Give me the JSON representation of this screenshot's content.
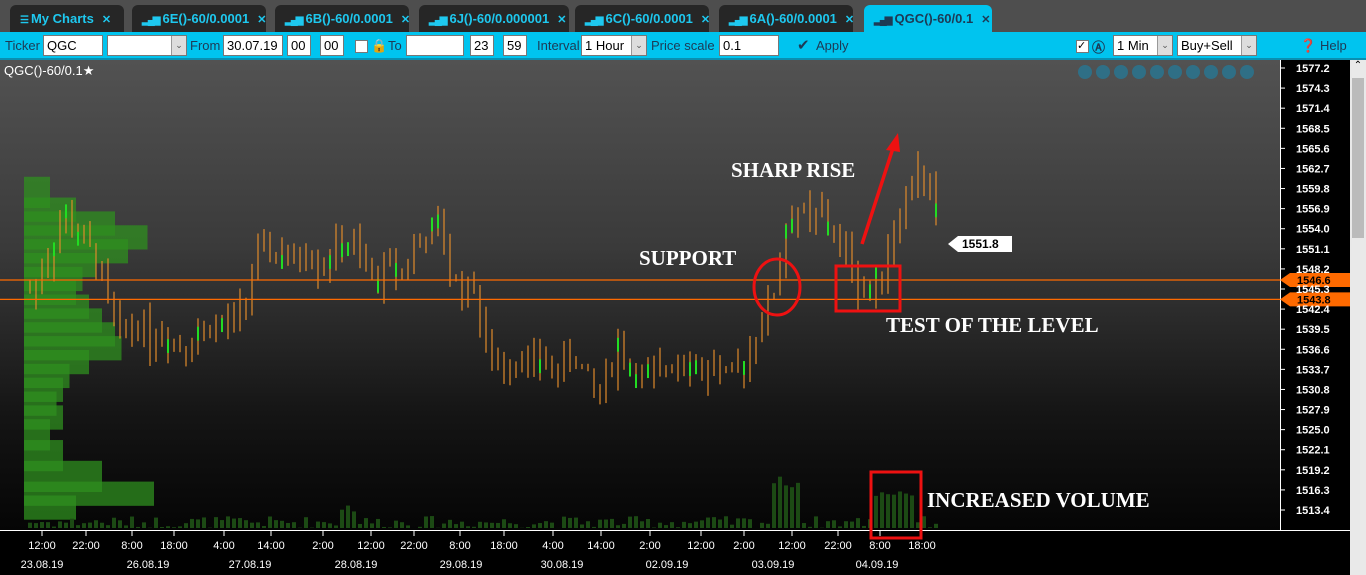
{
  "tabs": [
    {
      "label": "My Charts",
      "icon": "menu-icon"
    },
    {
      "label": "6E()-60/0.0001",
      "icon": "bar-chart-icon"
    },
    {
      "label": "6B()-60/0.0001",
      "icon": "bar-chart-icon"
    },
    {
      "label": "6J()-60/0.000001",
      "icon": "bar-chart-icon"
    },
    {
      "label": "6C()-60/0.0001",
      "icon": "bar-chart-icon"
    },
    {
      "label": "6A()-60/0.0001",
      "icon": "bar-chart-icon"
    },
    {
      "label": "QGC()-60/0.1",
      "icon": "bar-chart-icon",
      "active": true
    }
  ],
  "toolbar": {
    "ticker_label": "Ticker",
    "ticker": "QGC",
    "from_label": "From",
    "from_date": "30.07.19",
    "from_h": "00",
    "from_m": "00",
    "to_label": "To",
    "to_date": "",
    "to_h": "23",
    "to_m": "59",
    "interval_label": "Interval",
    "interval": "1 Hour",
    "price_scale_label": "Price scale",
    "price_scale": "0.1",
    "apply": "Apply",
    "tf": "1 Min",
    "side": "Buy+Sell",
    "help": "Help"
  },
  "chart": {
    "title": "QGC()-60/0.1",
    "last_price": "1551.8",
    "levels": [
      "1546.6",
      "1543.8"
    ],
    "annotations": {
      "sharp_rise": "SHARP RISE",
      "support": "SUPPORT",
      "test": "TEST OF THE LEVEL",
      "volume": "INCREASED VOLUME"
    },
    "colors": {
      "candle": "#e08a2a",
      "accent_up": "#22dd22",
      "level": "#ff6a00",
      "annotation": "#ee1111"
    }
  },
  "chart_data": {
    "type": "candlestick",
    "y_ticks": [
      "1577.2",
      "1574.3",
      "1571.4",
      "1568.5",
      "1565.6",
      "1562.7",
      "1559.8",
      "1556.9",
      "1554.0",
      "1551.1",
      "1548.2",
      "1545.3",
      "1542.4",
      "1539.5",
      "1536.6",
      "1533.7",
      "1530.8",
      "1527.9",
      "1525.0",
      "1522.1",
      "1519.2",
      "1516.3",
      "1513.4"
    ],
    "ylim": [
      1513.4,
      1577.2
    ],
    "x_time_ticks": [
      "12:00",
      "22:00",
      "8:00",
      "18:00",
      "4:00",
      "14:00",
      "2:00",
      "12:00",
      "22:00",
      "8:00",
      "18:00",
      "4:00",
      "14:00",
      "2:00",
      "12:00",
      "2:00",
      "12:00",
      "22:00",
      "8:00",
      "18:00"
    ],
    "x_date_ticks": [
      "23.08.19",
      "26.08.19",
      "27.08.19",
      "28.08.19",
      "29.08.19",
      "30.08.19",
      "02.09.19",
      "03.09.19",
      "04.09.19"
    ],
    "closes": [
      1545,
      1548,
      1552,
      1556,
      1553,
      1551,
      1547,
      1540,
      1539,
      1541,
      1538,
      1539,
      1538,
      1537,
      1539,
      1540,
      1540,
      1541,
      1544,
      1550,
      1551,
      1550,
      1549,
      1551,
      1549,
      1550,
      1552,
      1551,
      1548,
      1547,
      1549,
      1548,
      1551,
      1553,
      1554,
      1548,
      1545,
      1546,
      1536,
      1534,
      1535,
      1536,
      1534,
      1535,
      1533,
      1536,
      1534,
      1530,
      1533,
      1537,
      1534,
      1533,
      1532,
      1534,
      1536,
      1535,
      1533,
      1535,
      1532,
      1533,
      1537,
      1541,
      1545,
      1554,
      1557,
      1555,
      1556,
      1553,
      1550,
      1546,
      1545,
      1548,
      1554,
      1558,
      1563,
      1559,
      1552
    ],
    "volume_profile": [
      [
        1560,
        20
      ],
      [
        1557,
        40
      ],
      [
        1555,
        70
      ],
      [
        1553,
        95
      ],
      [
        1551,
        80
      ],
      [
        1549,
        55
      ],
      [
        1547,
        45
      ],
      [
        1545,
        40
      ],
      [
        1543,
        50
      ],
      [
        1541,
        60
      ],
      [
        1539,
        70
      ],
      [
        1537,
        75
      ],
      [
        1535,
        50
      ],
      [
        1533,
        35
      ],
      [
        1531,
        30
      ],
      [
        1529,
        25
      ],
      [
        1527,
        30
      ],
      [
        1525,
        20
      ],
      [
        1522,
        30
      ],
      [
        1519,
        60
      ],
      [
        1516,
        100
      ],
      [
        1514,
        40
      ]
    ]
  }
}
